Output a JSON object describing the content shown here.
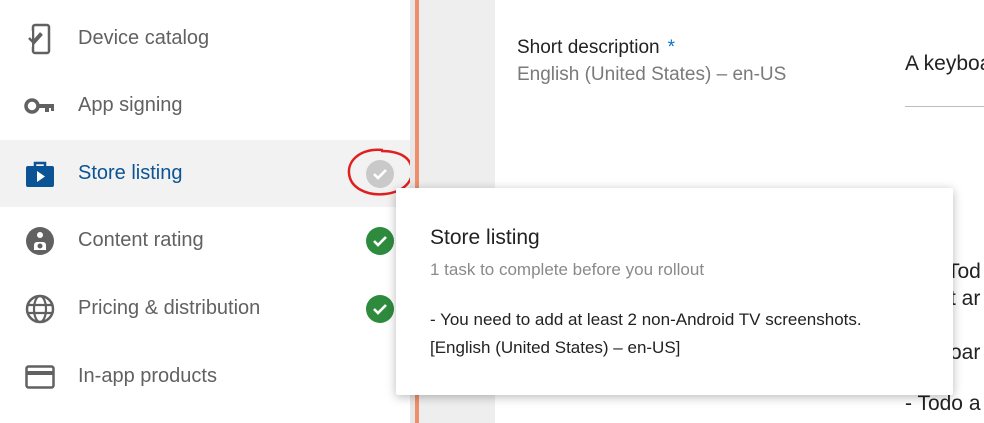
{
  "sidebar": {
    "items": [
      {
        "label": "Device catalog",
        "icon": "phone-check-icon",
        "status": "none"
      },
      {
        "label": "App signing",
        "icon": "key-icon",
        "status": "none"
      },
      {
        "label": "Store listing",
        "icon": "store-bag-icon",
        "status": "pending",
        "active": true
      },
      {
        "label": "Content rating",
        "icon": "content-rating-icon",
        "status": "done"
      },
      {
        "label": "Pricing & distribution",
        "icon": "globe-icon",
        "status": "done"
      },
      {
        "label": "In-app products",
        "icon": "card-icon",
        "status": "none"
      }
    ]
  },
  "main": {
    "short_description": {
      "label": "Short description",
      "required_mark": "*",
      "locale": "English (United States) – en-US",
      "value": "A keyboa"
    },
    "fragments": [
      "Tod",
      "t ar",
      "oar",
      "- Todo a"
    ]
  },
  "popover": {
    "title": "Store listing",
    "subtitle": "1 task to complete before you rollout",
    "message_line1": "- You need to add at least 2 non-Android TV screenshots.",
    "message_line2": "[English (United States) – en-US]"
  },
  "colors": {
    "accent_blue": "#0b5394",
    "required_blue": "#0b73c9",
    "done_green": "#2e8b3e",
    "pending_gray": "#c9c9c9",
    "annotation_red": "#e02020",
    "divider_orange": "#ef8f6a"
  }
}
